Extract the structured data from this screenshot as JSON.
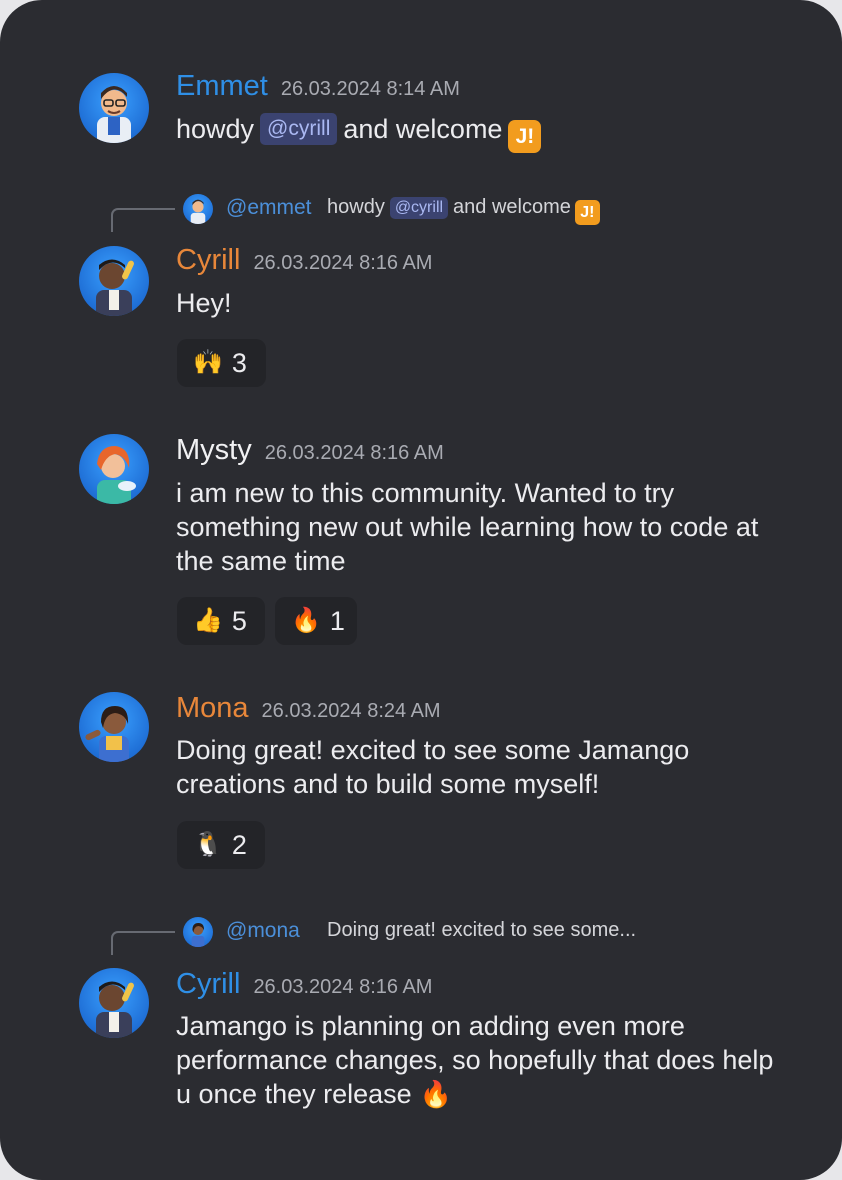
{
  "messages": [
    {
      "author": "Emmet",
      "time": "26.03.2024 8:14 AM",
      "text_before": "howdy",
      "mention": "@cyrill",
      "text_after": "and welcome",
      "logo": "J!"
    },
    {
      "reply": {
        "user": "@emmet",
        "text_before": "howdy",
        "mention": "@cyrill",
        "text_after": "and welcome",
        "logo": "J!"
      },
      "author": "Cyrill",
      "time": "26.03.2024 8:16 AM",
      "text": "Hey!",
      "reactions": [
        {
          "emoji": "🙌",
          "count": "3"
        }
      ]
    },
    {
      "author": "Mysty",
      "time": "26.03.2024 8:16 AM",
      "text": "i am new to this community. Wanted to try something new out while learning how to code at the same time",
      "reactions": [
        {
          "emoji": "👍",
          "count": "5"
        },
        {
          "emoji": "🔥",
          "count": "1"
        }
      ]
    },
    {
      "author": "Mona",
      "time": "26.03.2024 8:24 AM",
      "text": "Doing great! excited to see some Jamango creations and to build some myself!",
      "reactions": [
        {
          "emoji": "🐧",
          "count": "2"
        }
      ]
    },
    {
      "reply": {
        "user": "@mona",
        "text": "Doing great! excited to see some..."
      },
      "author": "Cyrill",
      "time": "26.03.2024 8:16 AM",
      "text": "Jamango is planning on adding even more performance changes, so hopefully that does help u once they release",
      "emoji": "🔥"
    }
  ],
  "colors": {
    "background": "#2b2c31",
    "name_blue": "#2f8fe6",
    "name_orange": "#e8873a",
    "mention_bg": "#3b4370",
    "logo_orange": "#f29c1e"
  }
}
